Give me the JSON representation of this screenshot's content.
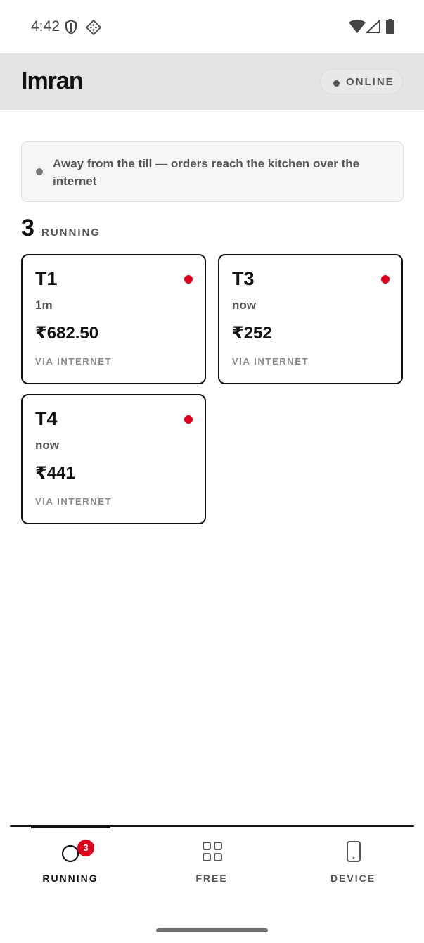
{
  "status_bar": {
    "time": "4:42",
    "icons": [
      "shield-icon",
      "diamond-grid-icon",
      "wifi-icon",
      "cell-signal-icon",
      "battery-icon"
    ]
  },
  "header": {
    "title": "Imran",
    "status": "ONLINE"
  },
  "notice": {
    "text": "Away from the till — orders reach the kitchen over the internet"
  },
  "running": {
    "count": "3",
    "label": "RUNNING"
  },
  "tables": [
    {
      "name": "T1",
      "time": "1m",
      "amount": "₹682.50",
      "source": "VIA INTERNET"
    },
    {
      "name": "T3",
      "time": "now",
      "amount": "₹252",
      "source": "VIA INTERNET"
    },
    {
      "name": "T4",
      "time": "now",
      "amount": "₹441",
      "source": "VIA INTERNET"
    }
  ],
  "nav": {
    "running": {
      "label": "RUNNING",
      "badge": "3",
      "icon": "ring-icon"
    },
    "free": {
      "label": "FREE",
      "icon": "grid-icon"
    },
    "device": {
      "label": "DEVICE",
      "icon": "phone-icon"
    }
  },
  "colors": {
    "accent": "#e0001b",
    "header_bg": "#e3e3e3",
    "text": "#111111",
    "muted": "#555555"
  }
}
